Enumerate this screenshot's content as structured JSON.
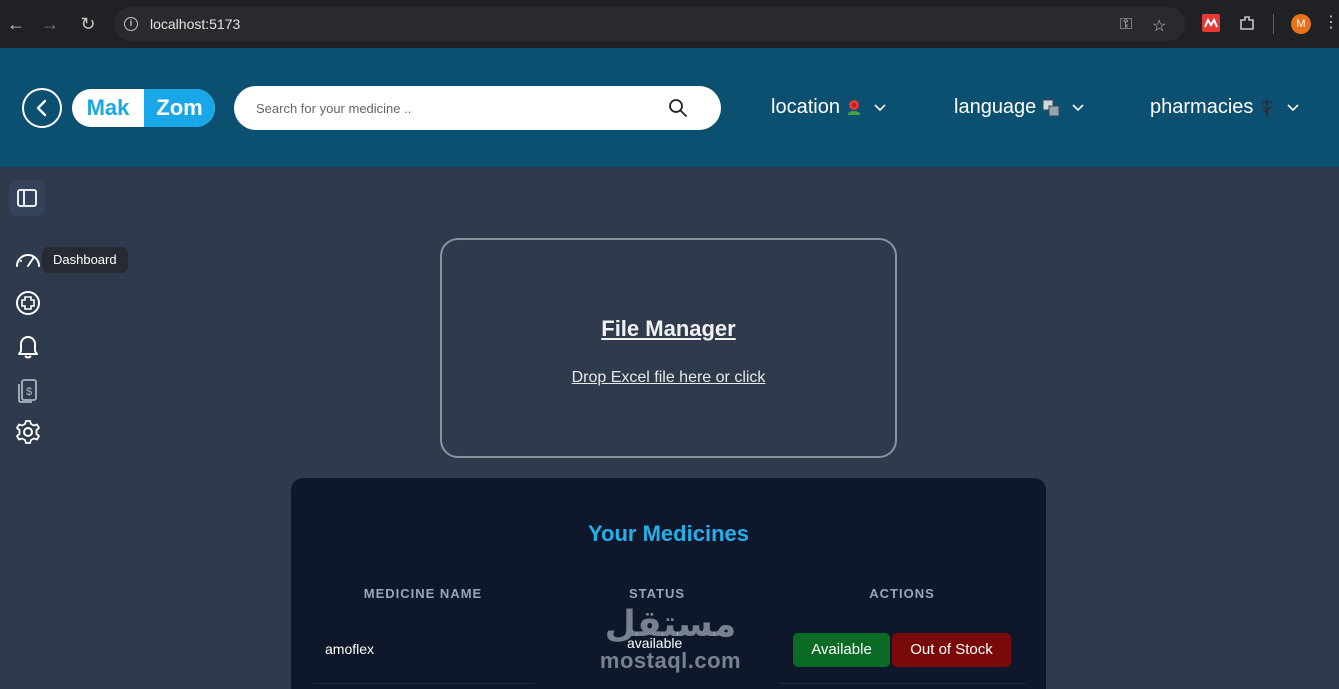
{
  "browser": {
    "url": "localhost:5173",
    "profile_initial": "M"
  },
  "header": {
    "logo_left": "Mak",
    "logo_right": "Zom",
    "search_placeholder": "Search for your medicine ..",
    "menu": {
      "location": "location",
      "language": "language",
      "pharmacies": "pharmacies"
    }
  },
  "sidebar": {
    "tooltip": "Dashboard",
    "items": [
      "dashboard-icon",
      "add-icon",
      "bell-icon",
      "billing-icon",
      "gear-icon"
    ]
  },
  "file_manager": {
    "title": "File Manager",
    "hint": "Drop Excel file here or click"
  },
  "medicines": {
    "title": "Your Medicines",
    "columns": [
      "MEDICINE NAME",
      "STATUS",
      "ACTIONS"
    ],
    "rows": [
      {
        "name": "amoflex",
        "status": "available",
        "actions": [
          "Available",
          "Out of Stock"
        ]
      }
    ]
  },
  "watermark": {
    "arabic": "مستقل",
    "latin": "mostaql.com"
  },
  "colors": {
    "header_bg": "#0b4f71",
    "page_bg": "#2f3b4c",
    "card_bg": "#0f172a",
    "accent": "#23b0ea",
    "available": "#0b6b25",
    "out_of_stock": "#7a0a0a"
  }
}
